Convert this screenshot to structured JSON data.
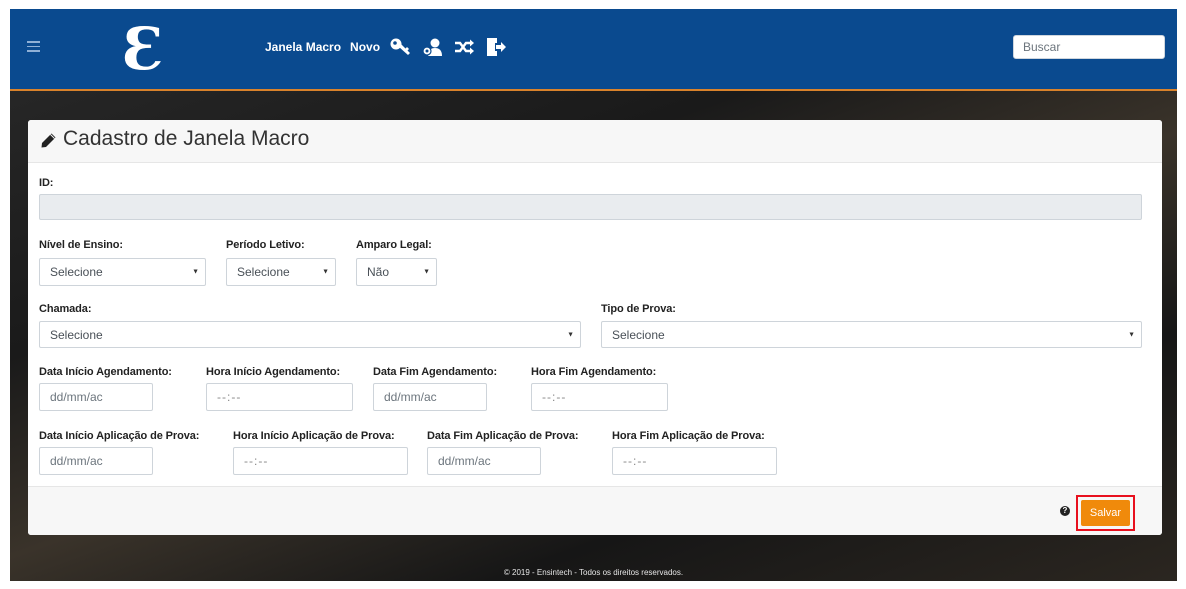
{
  "navbar": {
    "logo_glyph": "Ɛ",
    "links": [
      "Janela Macro",
      "Novo"
    ],
    "icons": [
      "key-icon",
      "users-cog-icon",
      "shuffle-icon",
      "sign-out-icon"
    ],
    "search_placeholder": "Buscar"
  },
  "card": {
    "title": "Cadastro de Janela Macro",
    "fields": {
      "id_label": "ID:",
      "id_value": "",
      "nivel_label": "Nível de Ensino:",
      "nivel_value": "Selecione",
      "periodo_label": "Período Letivo:",
      "periodo_value": "Selecione",
      "amparo_label": "Amparo Legal:",
      "amparo_value": "Não",
      "chamada_label": "Chamada:",
      "chamada_value": "Selecione",
      "tipo_label": "Tipo de Prova:",
      "tipo_value": "Selecione",
      "data_ini_ag_label": "Data Início Agendamento:",
      "hora_ini_ag_label": "Hora Início Agendamento:",
      "data_fim_ag_label": "Data Fim Agendamento:",
      "hora_fim_ag_label": "Hora Fim Agendamento:",
      "data_ini_ap_label": "Data Início Aplicação de Prova:",
      "hora_ini_ap_label": "Hora Início Aplicação de Prova:",
      "data_fim_ap_label": "Data Fim Aplicação de Prova:",
      "hora_fim_ap_label": "Hora Fim Aplicação de Prova:",
      "date_placeholder": "dd/mm/ac",
      "time_placeholder": "--:--"
    },
    "help_glyph": "?",
    "save_label": "Salvar"
  },
  "footer": {
    "text": "© 2019 - Ensintech - Todos os direitos reservados."
  },
  "colors": {
    "navbar": "#0a4a8f",
    "accent": "#f08a0b",
    "highlight": "#e8101e"
  }
}
